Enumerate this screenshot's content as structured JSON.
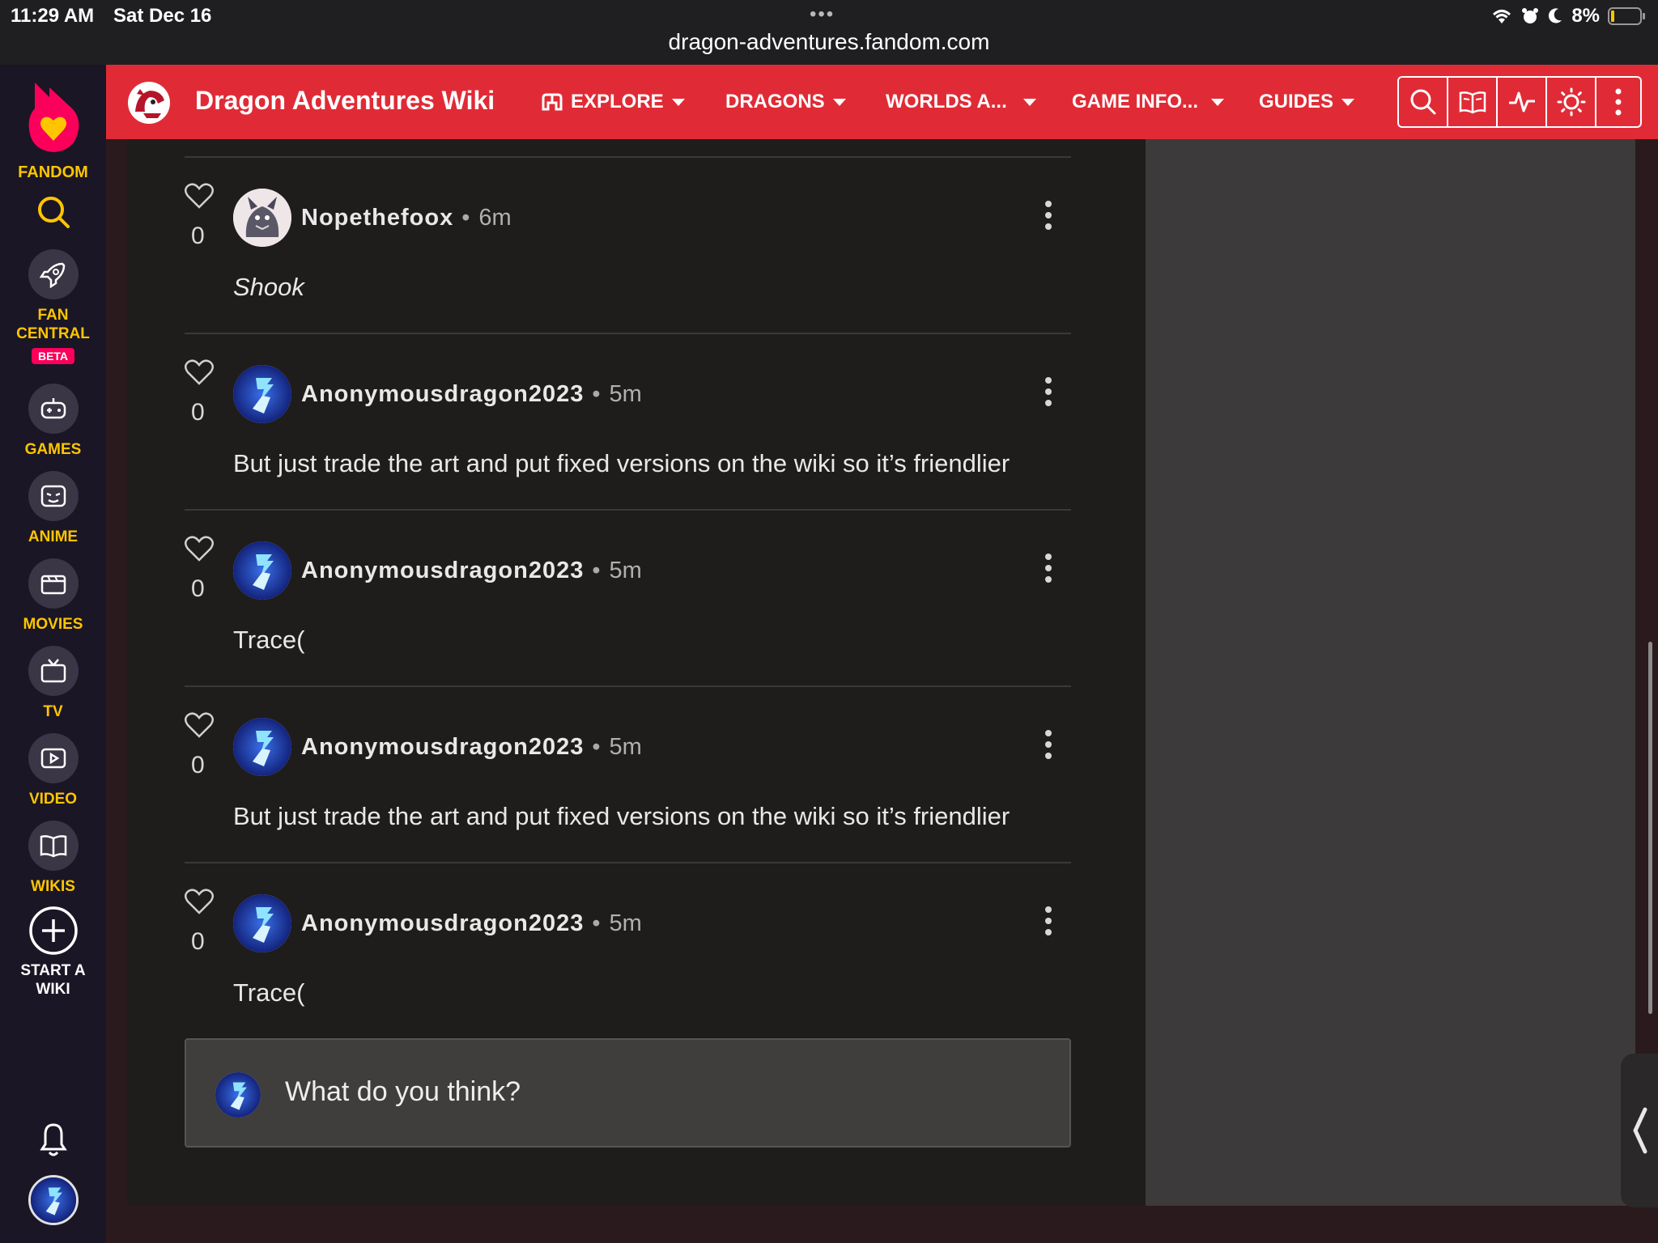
{
  "status_bar": {
    "time": "11:29 AM",
    "date": "Sat Dec 16",
    "dots": "•••",
    "url": "dragon-adventures.fandom.com",
    "battery_percent": "8%"
  },
  "rail": {
    "brand": "FANDOM",
    "items": [
      {
        "label": "FAN CENTRAL",
        "badge": "BETA"
      },
      {
        "label": "GAMES"
      },
      {
        "label": "ANIME"
      },
      {
        "label": "MOVIES"
      },
      {
        "label": "TV"
      },
      {
        "label": "VIDEO"
      },
      {
        "label": "WIKIS"
      }
    ],
    "start_wiki": "START A WIKI"
  },
  "wiki_header": {
    "name": "Dragon Adventures Wiki",
    "nav": [
      "EXPLORE",
      "DRAGONS",
      "WORLDS A...",
      "GAME INFO...",
      "GUIDES"
    ]
  },
  "comments": [
    {
      "likes": "0",
      "user": "Nopethefoox",
      "ago": "6m",
      "text": "Shook",
      "italic": true
    },
    {
      "likes": "0",
      "user": "Anonymousdragon2023",
      "ago": "5m",
      "text": "But just trade the art and put fixed versions on the wiki so it’s friendlier"
    },
    {
      "likes": "0",
      "user": "Anonymousdragon2023",
      "ago": "5m",
      "text": "Trace("
    },
    {
      "likes": "0",
      "user": "Anonymousdragon2023",
      "ago": "5m",
      "text": "But just trade the art and put fixed versions on the wiki so it’s friendlier"
    },
    {
      "likes": "0",
      "user": "Anonymousdragon2023",
      "ago": "5m",
      "text": "Trace("
    }
  ],
  "reply": {
    "placeholder": "What do you think?"
  },
  "colors": {
    "fandom_rail": "#1a1625",
    "fandom_accent": "#ffc500",
    "wiki_red": "#e02b36",
    "beta_badge": "#fa005a",
    "content_bg": "#1f1c1c"
  }
}
